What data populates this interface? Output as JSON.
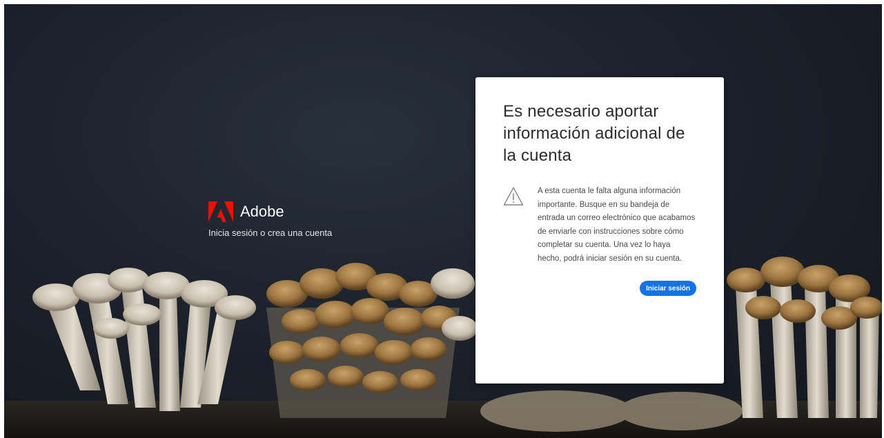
{
  "brand": {
    "name": "Adobe",
    "tagline": "Inicia sesión o crea una cuenta",
    "logo_icon": "adobe-logo-icon",
    "logo_color": "#eb1000"
  },
  "card": {
    "title": "Es necesario aportar información adicional de la cuenta",
    "icon": "warning-icon",
    "message": "A esta cuenta le falta alguna información importante. Busque en su bandeja de entrada un correo electrónico que acabamos de enviarle con instrucciones sobre cómo completar su cuenta. Una vez lo haya hecho, podrá iniciar sesión en su cuenta.",
    "button_label": "Iniciar sesión",
    "button_color": "#1473e6"
  }
}
